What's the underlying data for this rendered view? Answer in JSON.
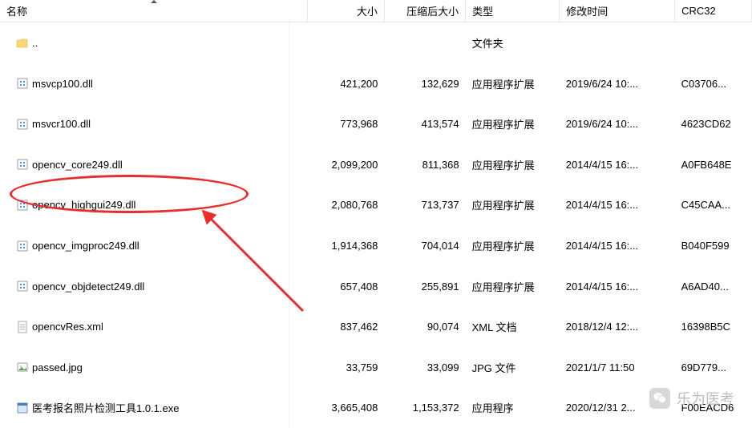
{
  "headers": {
    "name": "名称",
    "size": "大小",
    "compressed": "压缩后大小",
    "type": "类型",
    "mtime": "修改时间",
    "crc": "CRC32"
  },
  "parent_row": {
    "name": "..",
    "type": "文件夹"
  },
  "rows": [
    {
      "icon": "dll",
      "name": "msvcp100.dll",
      "size": "421,200",
      "compressed": "132,629",
      "type": "应用程序扩展",
      "mtime": "2019/6/24 10:...",
      "crc": "C03706..."
    },
    {
      "icon": "dll",
      "name": "msvcr100.dll",
      "size": "773,968",
      "compressed": "413,574",
      "type": "应用程序扩展",
      "mtime": "2019/6/24 10:...",
      "crc": "4623CD62"
    },
    {
      "icon": "dll",
      "name": "opencv_core249.dll",
      "size": "2,099,200",
      "compressed": "811,368",
      "type": "应用程序扩展",
      "mtime": "2014/4/15 16:...",
      "crc": "A0FB648E"
    },
    {
      "icon": "dll",
      "name": "opencv_highgui249.dll",
      "size": "2,080,768",
      "compressed": "713,737",
      "type": "应用程序扩展",
      "mtime": "2014/4/15 16:...",
      "crc": "C45CAA..."
    },
    {
      "icon": "dll",
      "name": "opencv_imgproc249.dll",
      "size": "1,914,368",
      "compressed": "704,014",
      "type": "应用程序扩展",
      "mtime": "2014/4/15 16:...",
      "crc": "B040F599"
    },
    {
      "icon": "dll",
      "name": "opencv_objdetect249.dll",
      "size": "657,408",
      "compressed": "255,891",
      "type": "应用程序扩展",
      "mtime": "2014/4/15 16:...",
      "crc": "A6AD40..."
    },
    {
      "icon": "xml",
      "name": "opencvRes.xml",
      "size": "837,462",
      "compressed": "90,074",
      "type": "XML 文档",
      "mtime": "2018/12/4 12:...",
      "crc": "16398B5C"
    },
    {
      "icon": "jpg",
      "name": "passed.jpg",
      "size": "33,759",
      "compressed": "33,099",
      "type": "JPG 文件",
      "mtime": "2021/1/7 11:50",
      "crc": "69D779..."
    },
    {
      "icon": "exe",
      "name": "医考报名照片检测工具1.0.1.exe",
      "size": "3,665,408",
      "compressed": "1,153,372",
      "type": "应用程序",
      "mtime": "2020/12/31 2...",
      "crc": "F00EACD6"
    }
  ],
  "watermark_text": "乐为医考"
}
